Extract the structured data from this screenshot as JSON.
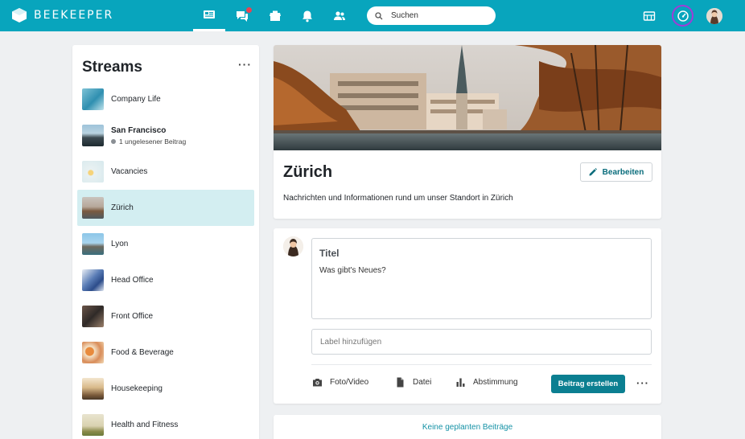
{
  "app": {
    "brand": "BEEKEEPER",
    "brand_color": "#08a5bd",
    "accent_color": "#0b7f91"
  },
  "topbar": {
    "nav": [
      {
        "icon": "newsfeed-icon",
        "active": true
      },
      {
        "icon": "chat-icon",
        "badge": true
      },
      {
        "icon": "apps-icon"
      },
      {
        "icon": "bell-icon"
      },
      {
        "icon": "people-icon"
      }
    ],
    "search_placeholder": "Suchen",
    "right_icons": [
      "directory-icon",
      "speedometer-icon",
      "avatar"
    ]
  },
  "sidebar": {
    "title": "Streams",
    "more": "···",
    "items": [
      {
        "label": "Company Life",
        "thumb": "company-life"
      },
      {
        "label": "San Francisco",
        "bold": true,
        "sub": "1 ungelesener Beitrag",
        "thumb": "san-francisco"
      },
      {
        "label": "Vacancies",
        "thumb": "vacancies"
      },
      {
        "label": "Zürich",
        "active": true,
        "thumb": "zurich"
      },
      {
        "label": "Lyon",
        "thumb": "lyon"
      },
      {
        "label": "Head Office",
        "thumb": "head-office"
      },
      {
        "label": "Front Office",
        "thumb": "front-office"
      },
      {
        "label": "Food & Beverage",
        "thumb": "food-beverage"
      },
      {
        "label": "Housekeeping",
        "thumb": "housekeeping"
      },
      {
        "label": "Health and Fitness",
        "thumb": "health-fitness"
      }
    ]
  },
  "stream": {
    "title": "Zürich",
    "edit_label": "Bearbeiten",
    "description": "Nachrichten und Informationen rund um unser Standort in Zürich"
  },
  "composer": {
    "title": "Titel",
    "placeholder": "Was gibt's Neues?",
    "label_placeholder": "Label hinzufügen",
    "actions": {
      "photo": "Foto/Video",
      "file": "Datei",
      "poll": "Abstimmung"
    },
    "submit": "Beitrag erstellen",
    "more": "···"
  },
  "planned": {
    "text": "Keine geplanten Beiträge"
  }
}
